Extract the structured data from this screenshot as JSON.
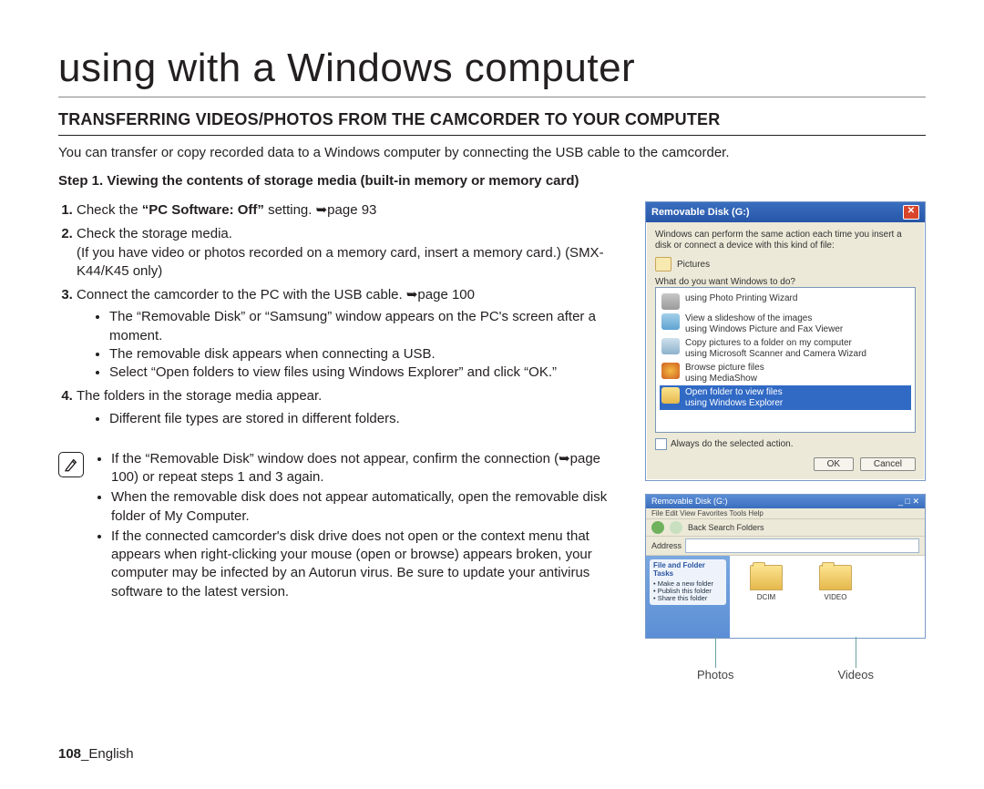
{
  "title": "using with a Windows computer",
  "section_heading": "TRANSFERRING VIDEOS/PHOTOS FROM THE CAMCORDER TO YOUR COMPUTER",
  "intro": "You can transfer or copy recorded data to a Windows computer by connecting the USB cable to the camcorder.",
  "step_title": "Step 1. Viewing the contents of storage media (built-in memory or memory card)",
  "steps": [
    {
      "prefix": "Check the ",
      "bold": "“PC Software: Off”",
      "suffix": " setting. ➥page 93",
      "sub": []
    },
    {
      "text": "Check the storage media.",
      "sub": [
        "(If you have video or photos recorded on a memory card, insert a memory card.) (SMX-K44/K45 only)"
      ]
    },
    {
      "text": "Connect the camcorder to the PC with the USB cable. ➥page 100",
      "bullets": [
        "The “Removable Disk” or “Samsung” window appears on the PC's screen after a moment.",
        "The removable disk appears when connecting a USB.",
        "Select “Open folders to view files using Windows Explorer” and click “OK.”"
      ]
    },
    {
      "text": "The folders in the storage media appear.",
      "bullets": [
        "Different file types are stored in different folders."
      ]
    }
  ],
  "notes": [
    "If the “Removable Disk” window does not appear, confirm the connection (➥page 100) or repeat steps 1 and 3 again.",
    "When the removable disk does not appear automatically, open the removable disk folder of My Computer.",
    "If the connected camcorder's disk drive does not open or the context menu that appears when right-clicking your mouse (open or browse) appears broken, your computer may be infected by an Autorun virus. Be sure to update your antivirus software to the latest version."
  ],
  "footer_page": "108",
  "footer_suffix": "_English",
  "dialog": {
    "title": "Removable Disk (G:)",
    "prompt1": "Windows can perform the same action each time you insert a disk or connect a device with this kind of file:",
    "icon_label": "Pictures",
    "prompt2": "What do you want Windows to do?",
    "options": [
      {
        "line1": "using Photo Printing Wizard"
      },
      {
        "line1": "View a slideshow of the images",
        "line2": "using Windows Picture and Fax Viewer"
      },
      {
        "line1": "Copy pictures to a folder on my computer",
        "line2": "using Microsoft Scanner and Camera Wizard"
      },
      {
        "line1": "Browse picture files",
        "line2": "using MediaShow"
      },
      {
        "line1": "Open folder to view files",
        "line2": "using Windows Explorer",
        "selected": true
      }
    ],
    "always_label": "Always do the selected action.",
    "ok": "OK",
    "cancel": "Cancel"
  },
  "explorer": {
    "title": "Removable Disk (G:)",
    "menu": "File   Edit   View   Favorites   Tools   Help",
    "toolbar": "Back        Search   Folders",
    "address_label": "Address",
    "side_group1_title": "File and Folder Tasks",
    "side_group1_items": "• Make a new folder\n• Publish this folder\n• Share this folder",
    "folders": [
      {
        "name": "DCIM"
      },
      {
        "name": "VIDEO"
      }
    ]
  },
  "callout_photos": "Photos",
  "callout_videos": "Videos"
}
